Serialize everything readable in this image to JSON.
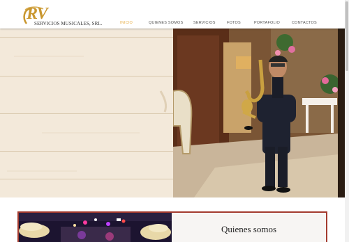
{
  "brand": {
    "logo_mark": "RV",
    "logo_text": "SERVICIOS MUSICALES, SRL.",
    "accent_color": "#e8b04a"
  },
  "nav": {
    "items": [
      {
        "label": "INICIO",
        "active": true
      },
      {
        "label": "QUIENES SOMOS",
        "active": false
      },
      {
        "label": "SERVICIOS",
        "active": false
      },
      {
        "label": "FOTOS",
        "active": false
      },
      {
        "label": "PORTAFOLIO",
        "active": false
      },
      {
        "label": "CONTACTOS",
        "active": false
      }
    ]
  },
  "about": {
    "title": "Quienes somos",
    "frame_color": "#a33a2e"
  }
}
